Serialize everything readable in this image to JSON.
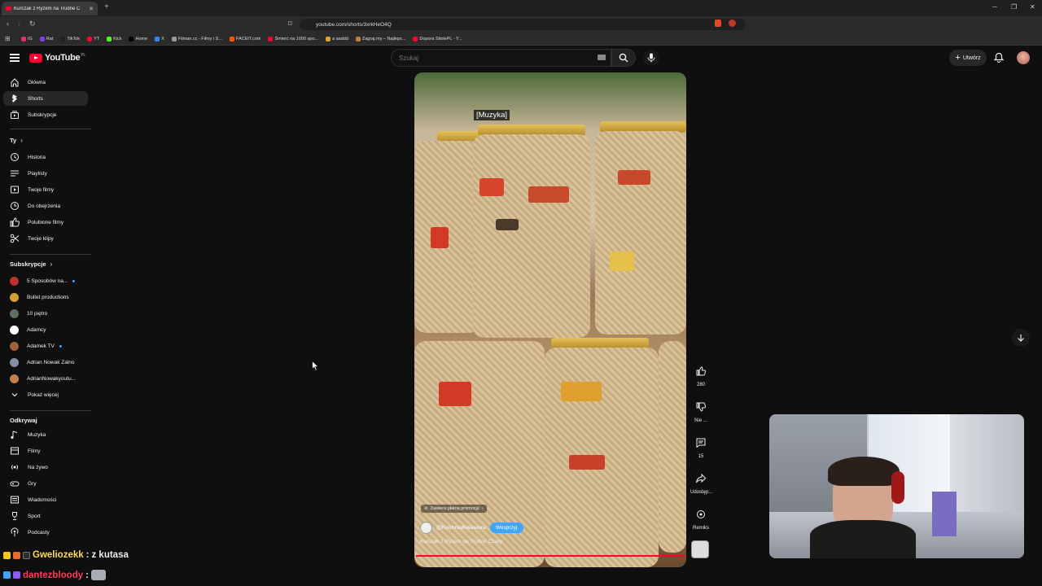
{
  "browser": {
    "tab_title": "Kurczak z Ryżem na Trudne C",
    "url": "youtube.com/shorts/3xrkHeO4Q",
    "bookmarks": [
      {
        "label": "IG",
        "color": "#e1306c"
      },
      {
        "label": "Rat",
        "color": "#7b3fe4"
      },
      {
        "label": "TikTok",
        "color": "#222222"
      },
      {
        "label": "YT",
        "color": "#ff0033"
      },
      {
        "label": "Kick",
        "color": "#53fc18"
      },
      {
        "label": "Home",
        "color": "#000000"
      },
      {
        "label": "X",
        "color": "#3b82f6"
      },
      {
        "label": "Filman.cc - Filmy i S...",
        "color": "#999999"
      },
      {
        "label": "FACEIT.com",
        "color": "#ff5500"
      },
      {
        "label": "Śmierć na 1000 spo...",
        "color": "#ff0033"
      },
      {
        "label": "a aaddd",
        "color": "#e0a030"
      },
      {
        "label": "Zagraj.my – Najleps...",
        "color": "#c08040"
      },
      {
        "label": "Dopora SitolePL - Y...",
        "color": "#ff0033"
      }
    ]
  },
  "header": {
    "logo_text": "YouTube",
    "logo_region": "PL",
    "search_placeholder": "Szukaj",
    "create_label": "Utwórz"
  },
  "sidebar": {
    "main": [
      {
        "label": "Główna",
        "icon": "home-icon"
      },
      {
        "label": "Shorts",
        "icon": "shorts-icon",
        "active": true
      },
      {
        "label": "Subskrypcje",
        "icon": "subscriptions-icon"
      }
    ],
    "you_heading": "Ty",
    "you": [
      {
        "label": "Historia",
        "icon": "history-icon"
      },
      {
        "label": "Playlisty",
        "icon": "playlist-icon"
      },
      {
        "label": "Twoje filmy",
        "icon": "your-videos-icon"
      },
      {
        "label": "Do obejrzenia",
        "icon": "watch-later-icon"
      },
      {
        "label": "Polubione filmy",
        "icon": "liked-icon"
      },
      {
        "label": "Twoje klipy",
        "icon": "clips-icon"
      }
    ],
    "subs_heading": "Subskrypcje",
    "subs": [
      {
        "label": "5 Sposobów na...",
        "color": "#c03030",
        "dot": true
      },
      {
        "label": "Bullet productions",
        "color": "#d0a030"
      },
      {
        "label": "10 piętro",
        "color": "#607060"
      },
      {
        "label": "Adamcy",
        "color": "#ffffff"
      },
      {
        "label": "Adamek TV",
        "color": "#a06040",
        "dot": true
      },
      {
        "label": "Adrian Nowak Zalno",
        "color": "#8090a0"
      },
      {
        "label": "AdrianNowakyoutu...",
        "color": "#c08050"
      }
    ],
    "show_more": "Pokaż więcej",
    "explore_heading": "Odkrywaj",
    "explore": [
      {
        "label": "Muzyka",
        "icon": "music-icon"
      },
      {
        "label": "Filmy",
        "icon": "film-icon"
      },
      {
        "label": "Na żywo",
        "icon": "live-icon"
      },
      {
        "label": "Gry",
        "icon": "gaming-icon"
      },
      {
        "label": "Wiadomości",
        "icon": "news-icon"
      },
      {
        "label": "Sport",
        "icon": "trophy-icon"
      },
      {
        "label": "Podcasty",
        "icon": "podcast-icon"
      }
    ]
  },
  "short": {
    "caption": "[Muzyka]",
    "promo": "Zawiera płatną promocję",
    "channel": "@KuchniaKwasiora",
    "join_label": "Wesprzyj",
    "title": "Kurczak z Ryżem na Trudne Czasy",
    "progress": 1.0,
    "actions": {
      "likes": "280",
      "dislike": "Nie ...",
      "comments": "15",
      "share": "Udostęp...",
      "remix": "Remiks"
    }
  },
  "chat": [
    {
      "user": "Gweliozekk",
      "message": "z kutasa",
      "color": "#ffe14d"
    },
    {
      "user": "dantezbloody",
      "message": "",
      "color": "#ff3b5c"
    }
  ]
}
